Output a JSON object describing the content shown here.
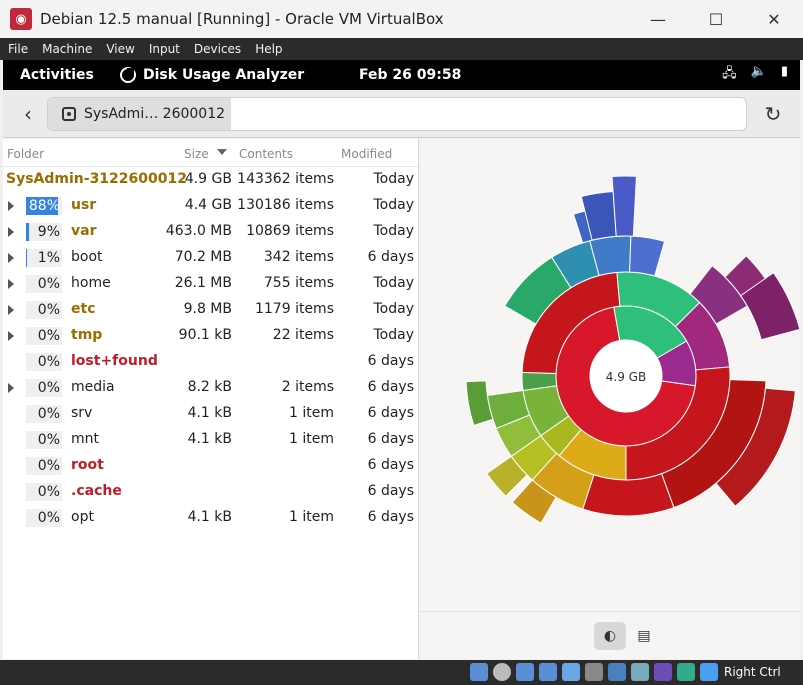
{
  "host_window": {
    "title": "Debian 12.5 manual [Running] - Oracle VM VirtualBox",
    "minimize": "—",
    "maximize": "☐",
    "close": "✕"
  },
  "vbox_menu": [
    "File",
    "Machine",
    "View",
    "Input",
    "Devices",
    "Help"
  ],
  "gnome_topbar": {
    "activities": "Activities",
    "app_name": "Disk Usage Analyzer",
    "clock": "Feb 26  09:58"
  },
  "header": {
    "path_segment": "SysAdmi… 2600012"
  },
  "list": {
    "columns": {
      "folder": "Folder",
      "size": "Size",
      "contents": "Contents",
      "modified": "Modified"
    },
    "root": {
      "name": "SysAdmin-3122600012",
      "size": "4.9 GB",
      "contents": "143362 items",
      "modified": "Today"
    },
    "rows": [
      {
        "pct": "88%",
        "fill": 0.88,
        "name": "usr",
        "size": "4.4 GB",
        "contents": "130186 items",
        "modified": "Today",
        "color": "#9a6b00",
        "expander": true
      },
      {
        "pct": "9%",
        "fill": 0.09,
        "name": "var",
        "size": "463.0 MB",
        "contents": "10869 items",
        "modified": "Today",
        "color": "#9a6b00",
        "expander": true
      },
      {
        "pct": "1%",
        "fill": 0.01,
        "name": "boot",
        "size": "70.2 MB",
        "contents": "342 items",
        "modified": "6 days",
        "color": "#222222",
        "expander": true
      },
      {
        "pct": "0%",
        "fill": 0,
        "name": "home",
        "size": "26.1 MB",
        "contents": "755 items",
        "modified": "Today",
        "color": "#222222",
        "expander": true
      },
      {
        "pct": "0%",
        "fill": 0,
        "name": "etc",
        "size": "9.8 MB",
        "contents": "1179 items",
        "modified": "Today",
        "color": "#9a6b00",
        "expander": true
      },
      {
        "pct": "0%",
        "fill": 0,
        "name": "tmp",
        "size": "90.1 kB",
        "contents": "22 items",
        "modified": "Today",
        "color": "#9a6b00",
        "expander": true
      },
      {
        "pct": "0%",
        "fill": 0,
        "name": "lost+found",
        "size": "",
        "contents": "",
        "modified": "6 days",
        "color": "#c01c28",
        "expander": false
      },
      {
        "pct": "0%",
        "fill": 0,
        "name": "media",
        "size": "8.2 kB",
        "contents": "2 items",
        "modified": "6 days",
        "color": "#222222",
        "expander": true
      },
      {
        "pct": "0%",
        "fill": 0,
        "name": "srv",
        "size": "4.1 kB",
        "contents": "1 item",
        "modified": "6 days",
        "color": "#222222",
        "expander": false
      },
      {
        "pct": "0%",
        "fill": 0,
        "name": "mnt",
        "size": "4.1 kB",
        "contents": "1 item",
        "modified": "6 days",
        "color": "#222222",
        "expander": false
      },
      {
        "pct": "0%",
        "fill": 0,
        "name": "root",
        "size": "",
        "contents": "",
        "modified": "6 days",
        "color": "#c01c28",
        "expander": false
      },
      {
        "pct": "0%",
        "fill": 0,
        "name": ".cache",
        "size": "",
        "contents": "",
        "modified": "6 days",
        "color": "#c01c28",
        "expander": false
      },
      {
        "pct": "0%",
        "fill": 0,
        "name": "opt",
        "size": "4.1 kB",
        "contents": "1 item",
        "modified": "6 days",
        "color": "#222222",
        "expander": false
      }
    ]
  },
  "chart": {
    "center_label": "4.9 GB"
  },
  "vbox_status": {
    "host_key": "Right Ctrl"
  }
}
